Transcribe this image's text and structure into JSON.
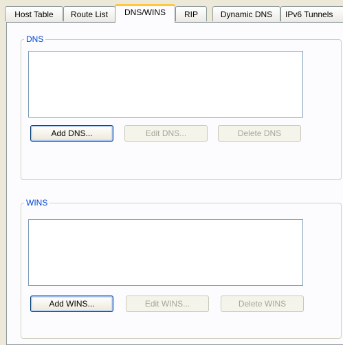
{
  "tabs": [
    {
      "label": "Host Table",
      "active": false
    },
    {
      "label": "Route List",
      "active": false
    },
    {
      "label": "DNS/WINS",
      "active": true
    },
    {
      "label": "RIP",
      "active": false
    },
    {
      "label": "Dynamic DNS",
      "active": false
    },
    {
      "label": "IPv6 Tunnels",
      "active": false
    }
  ],
  "dns": {
    "group_label": "DNS",
    "list_items": [],
    "buttons": {
      "add": {
        "label": "Add DNS...",
        "enabled": true
      },
      "edit": {
        "label": "Edit DNS...",
        "enabled": false
      },
      "delete": {
        "label": "Delete DNS",
        "enabled": false
      }
    }
  },
  "wins": {
    "group_label": "WINS",
    "list_items": [],
    "buttons": {
      "add": {
        "label": "Add WINS...",
        "enabled": true
      },
      "edit": {
        "label": "Edit WINS...",
        "enabled": false
      },
      "delete": {
        "label": "Delete WINS",
        "enabled": false
      }
    }
  },
  "colors": {
    "dialog_bg": "#ece9d8",
    "tab_highlight": "#ffc83c",
    "group_label": "#0046d5",
    "disabled_text": "#a4a598"
  }
}
